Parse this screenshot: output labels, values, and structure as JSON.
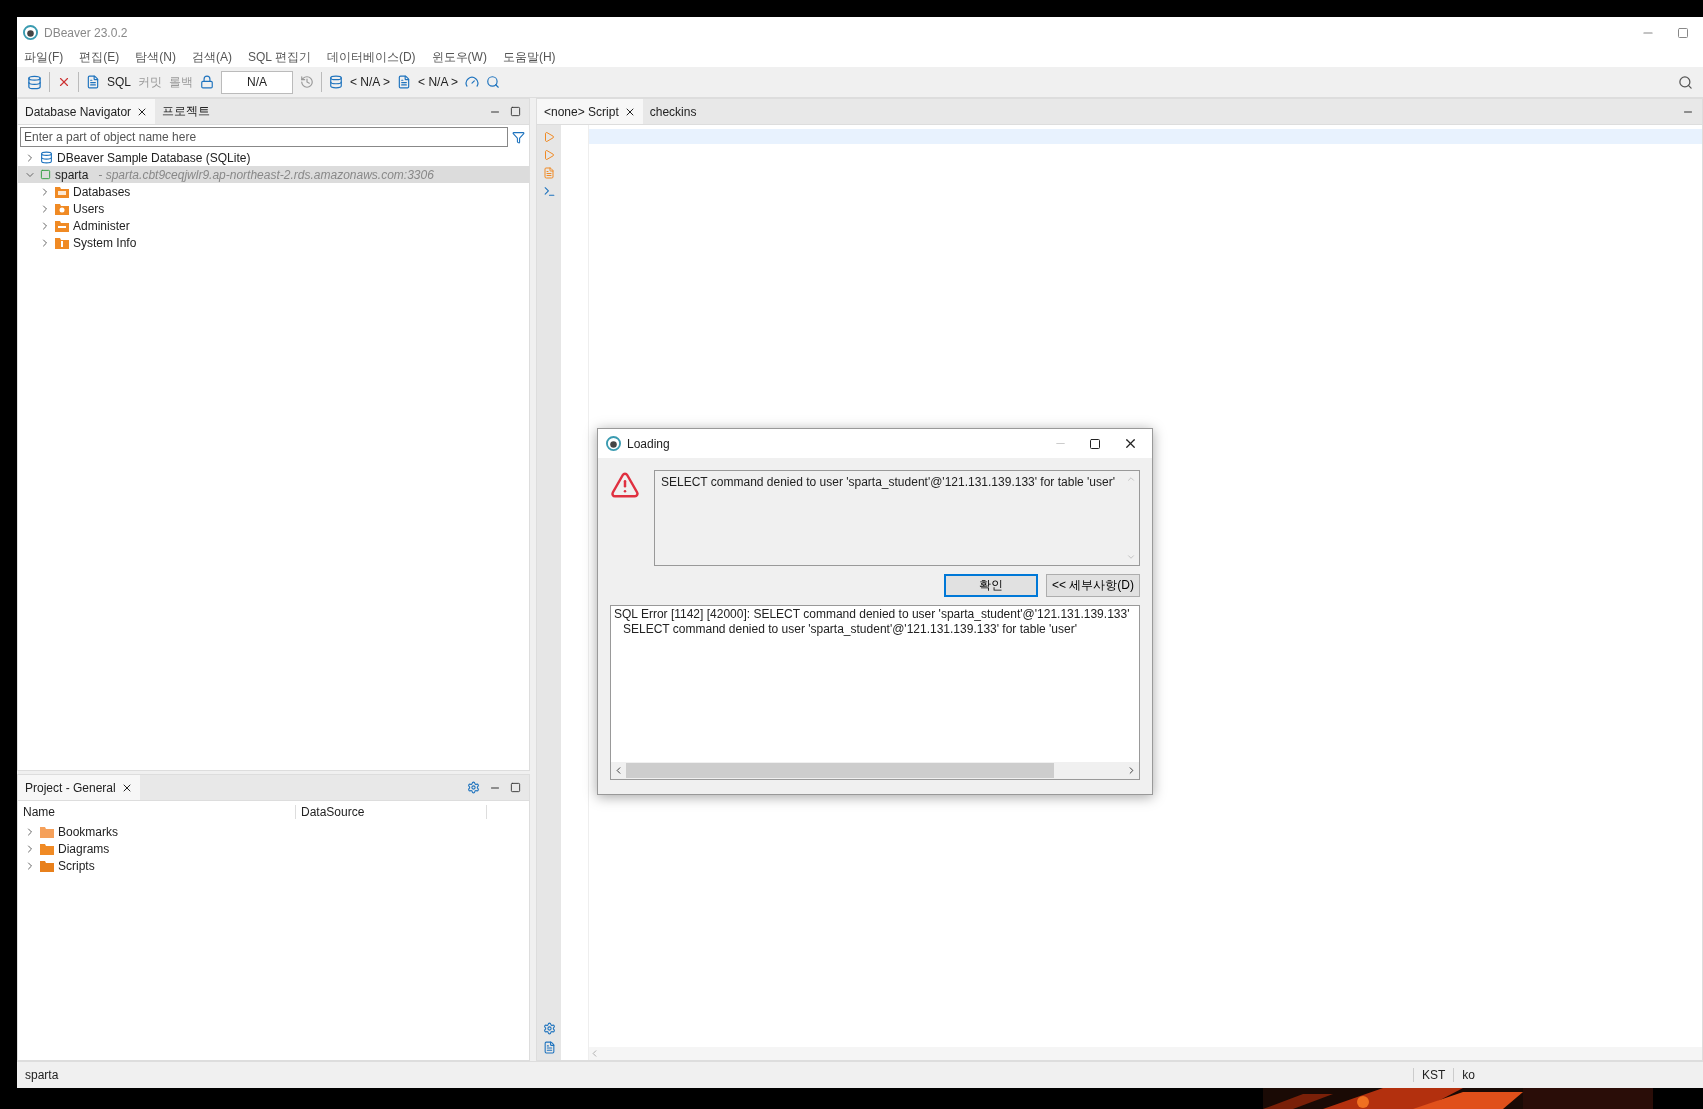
{
  "window": {
    "title": "DBeaver 23.0.2"
  },
  "menu": [
    "파일(F)",
    "편집(E)",
    "탐색(N)",
    "검색(A)",
    "SQL 편집기",
    "데이터베이스(D)",
    "윈도우(W)",
    "도움말(H)"
  ],
  "toolbar": {
    "sql": "SQL",
    "commit": "커밋",
    "rollback": "롤백",
    "transaction": "N/A",
    "datasource": "< N/A >",
    "schema": "< N/A >"
  },
  "navigator": {
    "tabs": [
      {
        "label": "Database Navigator",
        "selected": true
      },
      {
        "label": "프로젝트",
        "selected": false
      }
    ],
    "filter": {
      "placeholder": "Enter a part of object name here"
    },
    "tree": [
      {
        "label": "DBeaver Sample Database (SQLite)",
        "kind": "sqlite",
        "expanded": false,
        "selected": false
      },
      {
        "label": "sparta",
        "detail": "- sparta.cbt9ceqjwlr9.ap-northeast-2.rds.amazonaws.com:3306",
        "kind": "connection",
        "expanded": true,
        "selected": true,
        "children": [
          {
            "label": "Databases",
            "kind": "databases",
            "expanded": false,
            "selected": false
          },
          {
            "label": "Users",
            "kind": "users",
            "expanded": false,
            "selected": false
          },
          {
            "label": "Administer",
            "kind": "administer",
            "expanded": false,
            "selected": false
          },
          {
            "label": "System Info",
            "kind": "info",
            "expanded": false,
            "selected": false
          }
        ]
      }
    ]
  },
  "project": {
    "tab": "Project - General",
    "columns": [
      "Name",
      "DataSource"
    ],
    "items": [
      {
        "label": "Bookmarks",
        "kind": "bookmarks"
      },
      {
        "label": "Diagrams",
        "kind": "diagrams"
      },
      {
        "label": "Scripts",
        "kind": "scripts"
      }
    ]
  },
  "editor": {
    "tabs": [
      {
        "label": "<none> Script",
        "selected": true
      },
      {
        "label": "checkins",
        "selected": false
      }
    ]
  },
  "dialog": {
    "title": "Loading",
    "message": "SELECT command denied to user 'sparta_student'@'121.131.139.133' for table 'user'",
    "buttons": [
      {
        "label": "확인",
        "default": true
      },
      {
        "label": "<< 세부사항(D)",
        "default": false
      }
    ],
    "details": [
      "SQL Error [1142] [42000]: SELECT command denied to user 'sparta_student'@'121.131.139.133'",
      "SELECT command denied to user 'sparta_student'@'121.131.139.133' for table 'user'"
    ]
  },
  "status_bar": {
    "left": "sparta",
    "timezone": "KST",
    "locale": "ko"
  }
}
